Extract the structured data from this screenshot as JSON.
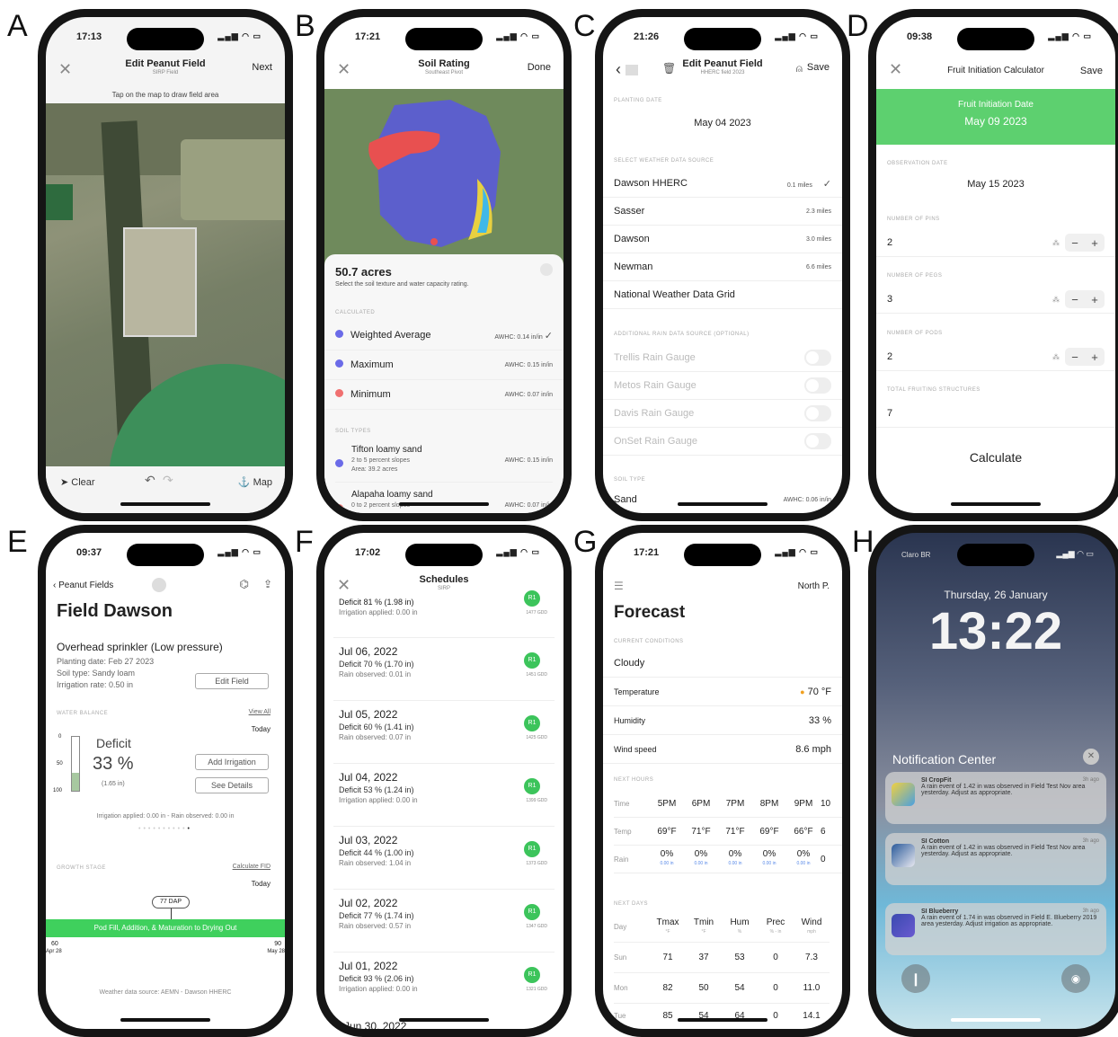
{
  "letters": [
    "A",
    "B",
    "C",
    "D",
    "E",
    "F",
    "G",
    "H"
  ],
  "a": {
    "time": "17:13",
    "title": "Edit Peanut Field",
    "subtitle": "SIRP Field",
    "next": "Next",
    "hint": "Tap on the map to draw field area",
    "clear": "Clear",
    "map": "Map"
  },
  "b": {
    "time": "17:21",
    "title": "Soil Rating",
    "subtitle": "Southeast Pivot",
    "done": "Done",
    "acres": "50.7 acres",
    "desc": "Select the soil texture and water capacity rating.",
    "calc_sec": "CALCULATED",
    "rows": [
      {
        "label": "Weighted Average",
        "val": "AWHC: 0.14 in/in",
        "check": "✓",
        "color": "#6b6be8"
      },
      {
        "label": "Maximum",
        "val": "AWHC: 0.15 in/in",
        "check": "",
        "color": "#6b6be8"
      },
      {
        "label": "Minimum",
        "val": "AWHC: 0.07 in/in",
        "check": "",
        "color": "#f07070"
      }
    ],
    "soil_sec": "SOIL TYPES",
    "soils": [
      {
        "name": "Tifton loamy sand",
        "l2": "2 to 5 percent slopes",
        "l3": "Area: 39.2 acres",
        "val": "AWHC: 0.15 in/in"
      },
      {
        "name": "Alapaha loamy sand",
        "l2": "0 to 2 percent slopes",
        "val": "AWHC: 0.07 in/in"
      }
    ]
  },
  "c": {
    "time": "21:26",
    "title": "Edit Peanut Field",
    "subtitle": "HHERC field 2023",
    "save": "Save",
    "plant_sec": "PLANTING DATE",
    "plant_date": "May 04 2023",
    "ws_sec": "SELECT WEATHER DATA SOURCE",
    "stations": [
      {
        "name": "Dawson HHERC",
        "dist": "0.1 miles",
        "check": "✓"
      },
      {
        "name": "Sasser",
        "dist": "2.3 miles",
        "check": ""
      },
      {
        "name": "Dawson",
        "dist": "3.0 miles",
        "check": ""
      },
      {
        "name": "Newman",
        "dist": "6.6 miles",
        "check": ""
      },
      {
        "name": "National Weather Data Grid",
        "dist": "",
        "check": ""
      }
    ],
    "rain_sec": "ADDITIONAL RAIN DATA SOURCE (OPTIONAL)",
    "gauges": [
      "Trellis Rain Gauge",
      "Metos Rain Gauge",
      "Davis Rain Gauge",
      "OnSet Rain Gauge"
    ],
    "soil_sec": "SOIL TYPE",
    "soil": "Sand",
    "soil_val": "AWHC: 0.06 in/in"
  },
  "d": {
    "time": "09:38",
    "title": "Fruit Initiation Calculator",
    "save": "Save",
    "banner1": "Fruit Initiation Date",
    "banner2": "May 09 2023",
    "obs_sec": "OBSERVATION DATE",
    "obs": "May 15 2023",
    "pins_sec": "NUMBER OF PINS",
    "pins": "2",
    "pegs_sec": "NUMBER OF PEGS",
    "pegs": "3",
    "pods_sec": "NUMBER OF PODS",
    "pods": "2",
    "total_sec": "TOTAL FRUITING STRUCTURES",
    "total": "7",
    "calc": "Calculate"
  },
  "e": {
    "time": "09:37",
    "back": "Peanut Fields",
    "title": "Field Dawson",
    "irr": "Overhead sprinkler (Low pressure)",
    "plant": "Planting date: Feb 27 2023",
    "soil": "Soil type: Sandy loam",
    "rate": "Irrigation rate: 0.50 in",
    "edit": "Edit Field",
    "wb": "WATER BALANCE",
    "viewall": "View All",
    "today": "Today",
    "deficit_lbl": "Deficit",
    "deficit": "33 %",
    "deficit_in": "(1.65 in)",
    "add": "Add Irrigation",
    "details": "See Details",
    "ticks": [
      "0",
      "50",
      "100"
    ],
    "applied": "Irrigation applied: 0.00 in - Rain observed: 0.00 in",
    "growth": "GROWTH STAGE",
    "calcfid": "Calculate FID",
    "today2": "Today",
    "dap": "77 DAP",
    "stage": "Pod Fill, Addition, & Maturation to Drying Out",
    "x1": "60",
    "x1d": "Apr 28",
    "x2": "90",
    "x2d": "May 28",
    "footer": "Weather data source: AEMN - Dawson HHERC"
  },
  "f": {
    "time": "17:02",
    "title": "Schedules",
    "subtitle": "SIRP",
    "top": {
      "s": "Deficit 81 % (1.98 in)",
      "o": "Irrigation applied: 0.00 in",
      "gdd": "1477 GDD"
    },
    "cards": [
      {
        "d": "Jul 06, 2022",
        "s": "Deficit 70 % (1.70 in)",
        "o": "Rain observed: 0.01 in",
        "gdd": "1451 GDD"
      },
      {
        "d": "Jul 05, 2022",
        "s": "Deficit 60 % (1.41 in)",
        "o": "Rain observed: 0.07 in",
        "gdd": "1425 GDD"
      },
      {
        "d": "Jul 04, 2022",
        "s": "Deficit 53 % (1.24 in)",
        "o": "Irrigation applied: 0.00 in",
        "gdd": "1399 GDD"
      },
      {
        "d": "Jul 03, 2022",
        "s": "Deficit 44 % (1.00 in)",
        "o": "Rain observed: 1.04 in",
        "gdd": "1373 GDD"
      },
      {
        "d": "Jul 02, 2022",
        "s": "Deficit 77 % (1.74 in)",
        "o": "Rain observed: 0.57 in",
        "gdd": "1347 GDD"
      },
      {
        "d": "Jul 01, 2022",
        "s": "Deficit 93 % (2.06 in)",
        "o": "Irrigation applied: 0.00 in",
        "gdd": "1321 GDD"
      }
    ],
    "badge": "R1",
    "partial": "Jun 30, 2022"
  },
  "g": {
    "time": "17:21",
    "loc": "North P.",
    "title": "Forecast",
    "cur_sec": "CURRENT CONDITIONS",
    "cond": "Cloudy",
    "temp_l": "Temperature",
    "temp": "70 °F",
    "hum_l": "Humidity",
    "hum": "33 %",
    "wind_l": "Wind speed",
    "wind": "8.6 mph",
    "hours_sec": "NEXT HOURS",
    "time_l": "Time",
    "hours": [
      "5PM",
      "6PM",
      "7PM",
      "8PM",
      "9PM",
      "10"
    ],
    "temp2_l": "Temp",
    "temps": [
      "69°F",
      "71°F",
      "71°F",
      "69°F",
      "66°F",
      "6"
    ],
    "rain_l": "Rain",
    "rains": [
      "0%",
      "0%",
      "0%",
      "0%",
      "0%",
      "0"
    ],
    "rain_in": "0.00 in",
    "days_sec": "NEXT DAYS",
    "heads": [
      "Day",
      "Tmax",
      "Tmin",
      "Hum",
      "Prec",
      "Wind"
    ],
    "subs": [
      "",
      "°F",
      "°F",
      "%",
      "% - in",
      "mph"
    ],
    "days": [
      [
        "Sun",
        "71",
        "37",
        "53",
        "0",
        "7.3"
      ],
      [
        "Mon",
        "82",
        "50",
        "54",
        "0",
        "11.0"
      ],
      [
        "Tue",
        "85",
        "54",
        "64",
        "0",
        "14.1"
      ]
    ]
  },
  "h": {
    "carrier": "Claro BR",
    "date": "Thursday, 26 January",
    "clock": "13:22",
    "nc": "Notification Center",
    "notifs": [
      {
        "app": "SI CropFit",
        "tm": "3h ago",
        "body": "A rain event of 1.42 in was observed in Field Test Nov area yesterday. Adjust as appropriate.",
        "c": "#5aa0d8"
      },
      {
        "app": "SI Cotton",
        "tm": "3h ago",
        "body": "A rain event of 1.42 in was observed in Field Test Nov area yesterday. Adjust as appropriate.",
        "c": "#3a6ea8"
      },
      {
        "app": "SI Blueberry",
        "tm": "3h ago",
        "body": "A rain event of 1.74 in was observed in Field E. Blueberry 2019 area yesterday. Adjust irrigation as appropriate.",
        "c": "#4a5ab0"
      }
    ]
  }
}
